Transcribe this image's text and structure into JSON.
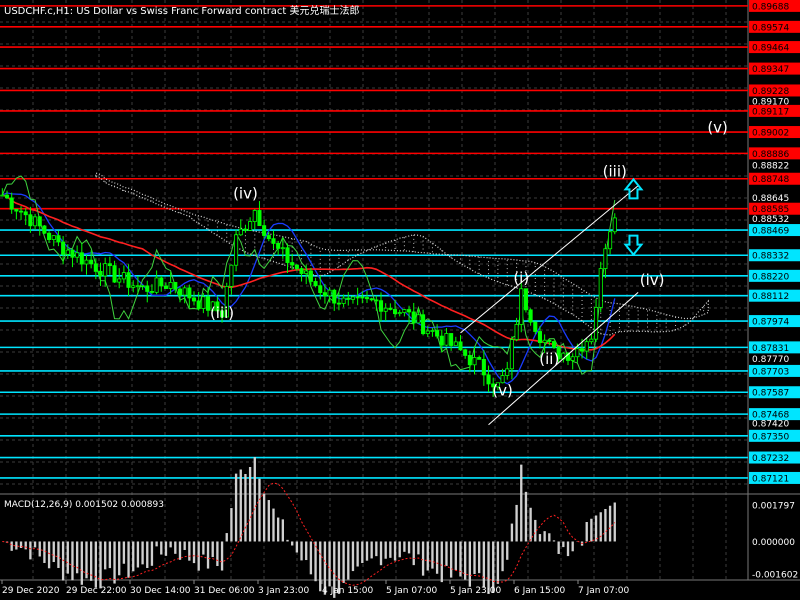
{
  "header": {
    "title": "USDCHF.c,H1:  US Dollar vs Swiss Franc Forward contract  美元兑瑞士法郎"
  },
  "macd": {
    "label": "MACD(12,26,9) 0.001502 0.000893",
    "levels": [
      {
        "label": "0.001797",
        "value": 0.001797
      },
      {
        "label": "0.000000",
        "value": 0.0
      },
      {
        "label": "-0.001602",
        "value": -0.001602
      }
    ]
  },
  "colors": {
    "background": "#000000",
    "candles": "#00ff00",
    "red_level": "#ff0000",
    "cyan_level": "#00e5ff",
    "ema_red": "#ff2020",
    "ema_blue": "#1a3cff",
    "line_green": "#3fd43f",
    "channel": "#ffffff",
    "arrow": "#00e5ff"
  },
  "chart_data": {
    "type": "candlestick",
    "symbol": "USDCHF.c",
    "timeframe": "H1",
    "ylim": [
      0.8705,
      0.8972
    ],
    "grid": true,
    "x_labels": [
      "29 Dec 2020",
      "29 Dec 22:00",
      "30 Dec 14:00",
      "31 Dec 06:00",
      "3 Jan 23:00",
      "4 Jan 15:00",
      "5 Jan 07:00",
      "5 Jan 23:00",
      "6 Jan 15:00",
      "7 Jan 07:00"
    ],
    "y_ticks": [
      {
        "label": "0.89688",
        "value": 0.89688,
        "kind": "red"
      },
      {
        "label": "0.89574",
        "value": 0.89574,
        "kind": "red"
      },
      {
        "label": "0.89464",
        "value": 0.89464,
        "kind": "red"
      },
      {
        "label": "0.89347",
        "value": 0.89347,
        "kind": "red"
      },
      {
        "label": "0.89228",
        "value": 0.89228,
        "kind": "red"
      },
      {
        "label": "0.89170",
        "value": 0.8917,
        "kind": "plain"
      },
      {
        "label": "0.89117",
        "value": 0.89117,
        "kind": "red"
      },
      {
        "label": "0.89002",
        "value": 0.89002,
        "kind": "red"
      },
      {
        "label": "0.88886",
        "value": 0.88886,
        "kind": "red"
      },
      {
        "label": "0.88822",
        "value": 0.88822,
        "kind": "plain"
      },
      {
        "label": "0.88748",
        "value": 0.88748,
        "kind": "red"
      },
      {
        "label": "0.88645",
        "value": 0.88645,
        "kind": "plain"
      },
      {
        "label": "0.88585",
        "value": 0.88585,
        "kind": "red"
      },
      {
        "label": "0.88532",
        "value": 0.88532,
        "kind": "plain"
      },
      {
        "label": "0.88469",
        "value": 0.88469,
        "kind": "cyan"
      },
      {
        "label": "0.88332",
        "value": 0.88332,
        "kind": "cyan"
      },
      {
        "label": "0.88220",
        "value": 0.8822,
        "kind": "cyan"
      },
      {
        "label": "0.88112",
        "value": 0.88112,
        "kind": "cyan"
      },
      {
        "label": "0.87974",
        "value": 0.87974,
        "kind": "cyan"
      },
      {
        "label": "0.87831",
        "value": 0.87831,
        "kind": "cyan"
      },
      {
        "label": "0.87770",
        "value": 0.8777,
        "kind": "plain"
      },
      {
        "label": "0.87703",
        "value": 0.87703,
        "kind": "cyan"
      },
      {
        "label": "0.87587",
        "value": 0.87587,
        "kind": "cyan"
      },
      {
        "label": "0.87468",
        "value": 0.87468,
        "kind": "cyan"
      },
      {
        "label": "0.87420",
        "value": 0.8742,
        "kind": "plain"
      },
      {
        "label": "0.87350",
        "value": 0.8735,
        "kind": "cyan"
      },
      {
        "label": "0.87232",
        "value": 0.87232,
        "kind": "cyan"
      },
      {
        "label": "0.87121",
        "value": 0.87121,
        "kind": "cyan"
      }
    ],
    "wave_labels": [
      {
        "text": "(iv)",
        "bar": 52,
        "price": 0.8864
      },
      {
        "text": "(iii)",
        "bar": 47,
        "price": 0.8799
      },
      {
        "text": "(i)",
        "bar": 111,
        "price": 0.8818
      },
      {
        "text": "(ii)",
        "bar": 117,
        "price": 0.8774
      },
      {
        "text": "(v)",
        "bar": 107,
        "price": 0.8757
      },
      {
        "text": "(iii)",
        "bar": 131,
        "price": 0.8876
      },
      {
        "text": "(iv)",
        "bar": 139,
        "price": 0.8817
      },
      {
        "text": "(v)",
        "bar": 153,
        "price": 0.89
      }
    ],
    "waypoints": [
      [
        0,
        0.8866
      ],
      [
        6,
        0.8853
      ],
      [
        12,
        0.8839
      ],
      [
        18,
        0.883
      ],
      [
        24,
        0.8822
      ],
      [
        30,
        0.8815
      ],
      [
        36,
        0.8818
      ],
      [
        42,
        0.8808
      ],
      [
        47,
        0.8802
      ],
      [
        50,
        0.8842
      ],
      [
        54,
        0.8858
      ],
      [
        58,
        0.8838
      ],
      [
        63,
        0.8826
      ],
      [
        68,
        0.8815
      ],
      [
        74,
        0.8806
      ],
      [
        80,
        0.8808
      ],
      [
        86,
        0.8802
      ],
      [
        90,
        0.8795
      ],
      [
        94,
        0.8788
      ],
      [
        98,
        0.8781
      ],
      [
        102,
        0.8773
      ],
      [
        106,
        0.8762
      ],
      [
        108,
        0.877
      ],
      [
        111,
        0.8812
      ],
      [
        115,
        0.879
      ],
      [
        118,
        0.878
      ],
      [
        122,
        0.878
      ],
      [
        126,
        0.879
      ],
      [
        129,
        0.884
      ],
      [
        131,
        0.8858
      ]
    ]
  }
}
